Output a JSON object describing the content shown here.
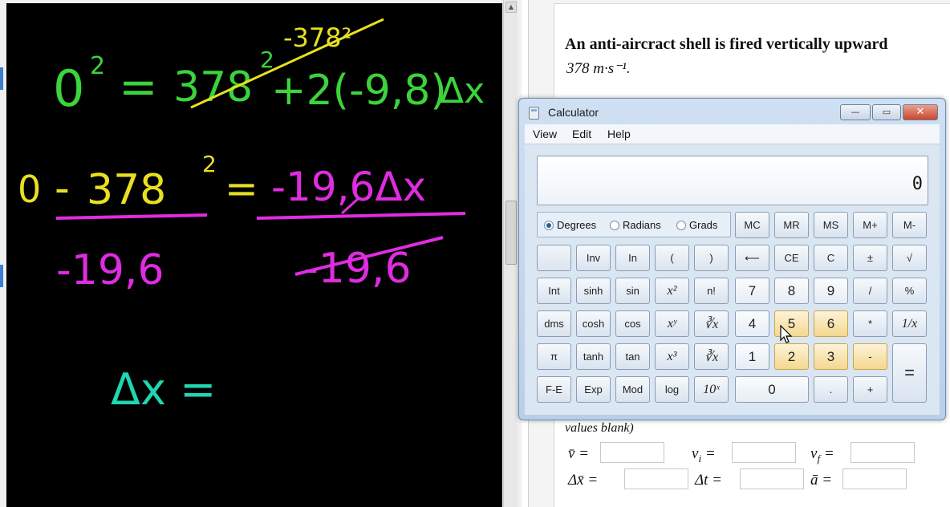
{
  "board": {
    "line1": {
      "lhs": "0",
      "lhs_exp": "2",
      "eq": "=",
      "term1": "378",
      "term1_exp": "2",
      "plus2": "+2(-9,8)",
      "dx": "Δx",
      "strike_annotation": "-378²"
    },
    "line2": {
      "lhs": "0",
      "minus": "-",
      "term": "378",
      "term_exp": "2",
      "eq": "=",
      "rhs": "-19,6Δx"
    },
    "line3": {
      "left_den": "-19,6",
      "right_den": "-19,6"
    },
    "line4": {
      "text": "Δx ="
    },
    "colors": {
      "green": "#3bd43b",
      "yellow": "#e8e020",
      "magenta": "#e02ce0",
      "teal": "#1fd6b0"
    }
  },
  "doc": {
    "title": "An anti-aircract shell is fired vertically upward",
    "speed": "378 m·s⁻¹.",
    "note": "values blank)",
    "vars": {
      "v_bar": "v̄ =",
      "v_i": "v",
      "v_i_sub": "i",
      "v_i_eq": " =",
      "v_f": "v",
      "v_f_sub": "f",
      "v_f_eq": " =",
      "dx_bar": "Δx̄ =",
      "dt": "Δt =",
      "a_bar": "ā ="
    }
  },
  "calc": {
    "title": "Calculator",
    "menu": [
      "View",
      "Edit",
      "Help"
    ],
    "display": "0",
    "angles": [
      "Degrees",
      "Radians",
      "Grads"
    ],
    "selected_angle": "Degrees",
    "memory": [
      "MC",
      "MR",
      "MS",
      "M+",
      "M-"
    ],
    "row2": [
      "",
      "Inv",
      "In",
      "(",
      ")",
      "⟵",
      "CE",
      "C",
      "±",
      "√"
    ],
    "row3": [
      "Int",
      "sinh",
      "sin",
      "x²",
      "n!",
      "7",
      "8",
      "9",
      "/",
      "%"
    ],
    "row4": [
      "dms",
      "cosh",
      "cos",
      "xʸ",
      "∛x",
      "4",
      "5",
      "6",
      "*",
      "1/x"
    ],
    "row5": [
      "π",
      "tanh",
      "tan",
      "x³",
      "∛x",
      "1",
      "2",
      "3",
      "-",
      "="
    ],
    "row6": [
      "F-E",
      "Exp",
      "Mod",
      "log",
      "10ˣ",
      "0",
      ".",
      "+"
    ],
    "window_buttons": {
      "min": "—",
      "max": "▭",
      "close": "✕"
    }
  }
}
